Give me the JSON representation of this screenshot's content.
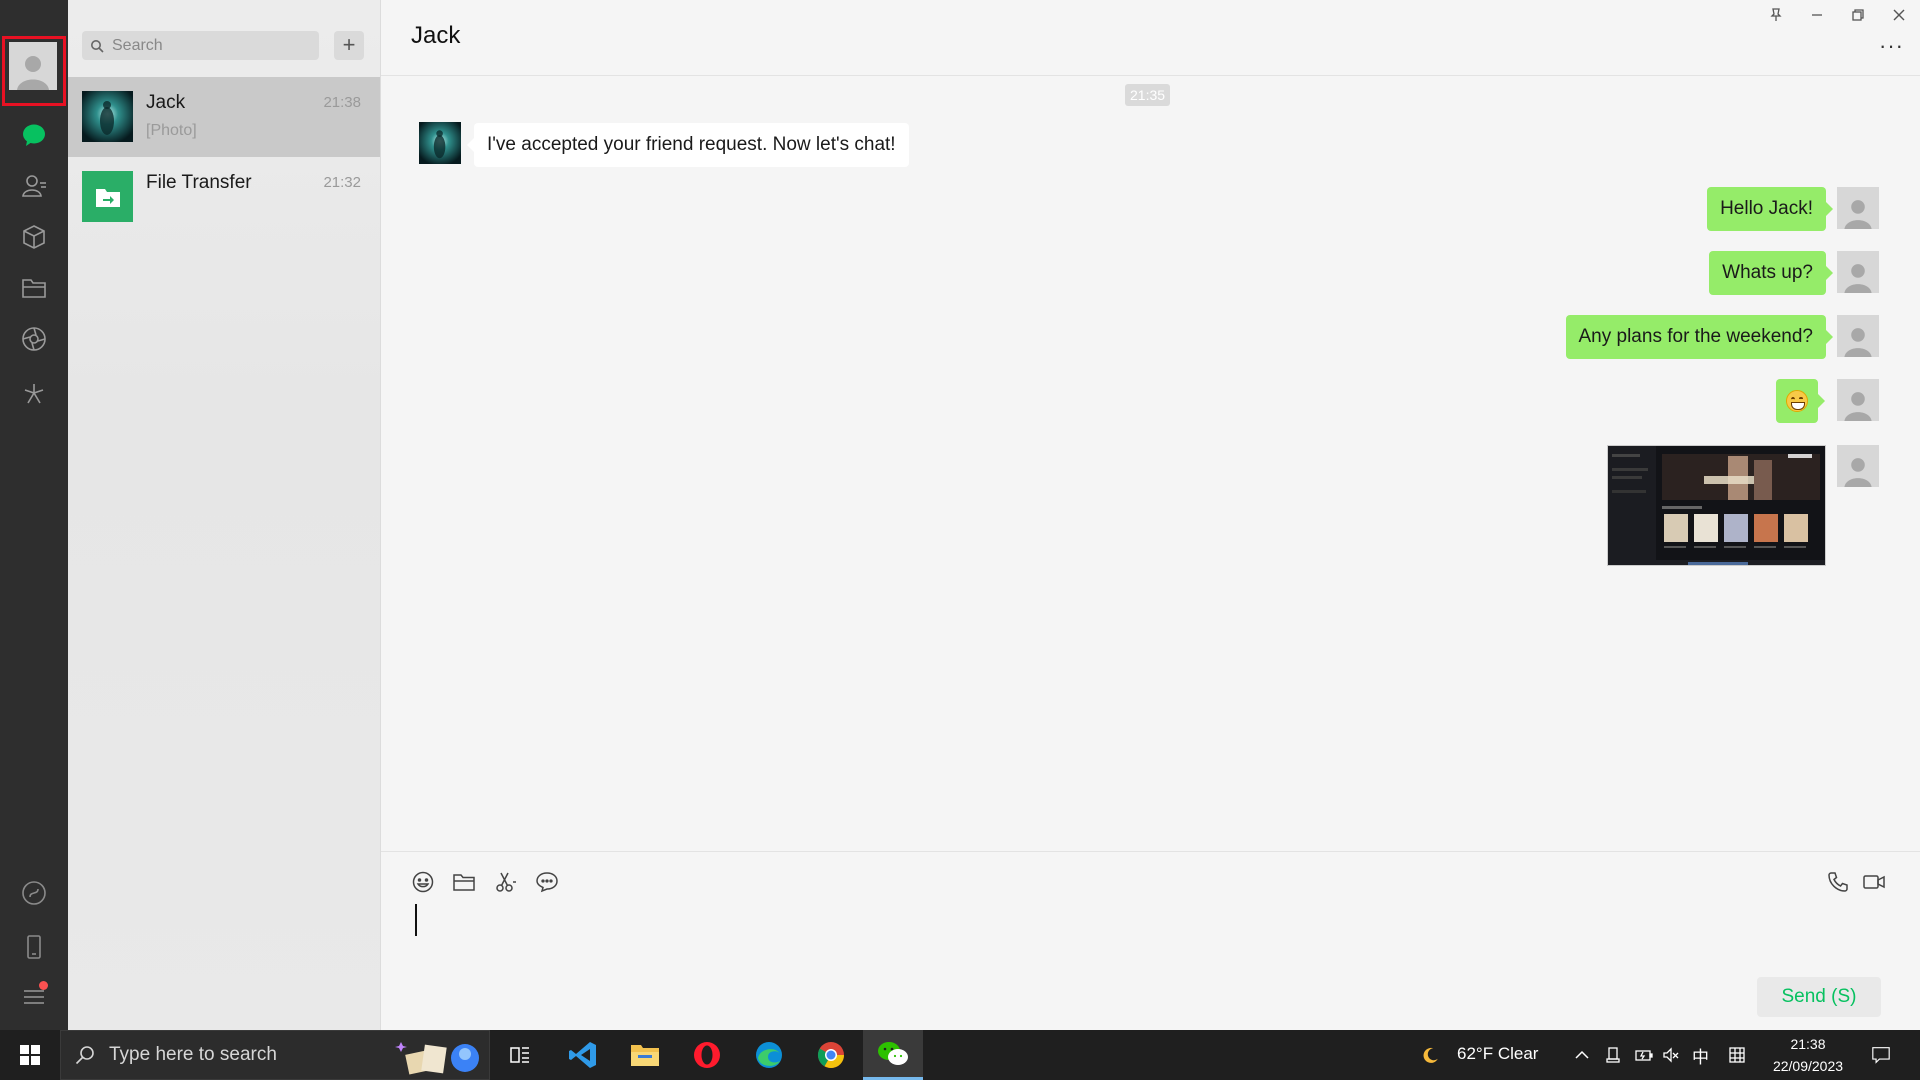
{
  "app": {
    "search": {
      "placeholder": "Search"
    },
    "add_label": "+"
  },
  "chats": [
    {
      "name": "Jack",
      "time": "21:38",
      "preview": "[Photo]",
      "active": true
    },
    {
      "name": "File Transfer",
      "time": "21:32",
      "preview": "",
      "active": false
    }
  ],
  "conversation": {
    "title": "Jack",
    "more_label": "···",
    "timestamp": "21:35",
    "messages": [
      {
        "from": "contact",
        "type": "text",
        "text": "I've accepted your friend request. Now let's chat!"
      },
      {
        "from": "me",
        "type": "text",
        "text": "Hello Jack!"
      },
      {
        "from": "me",
        "type": "text",
        "text": "Whats up?"
      },
      {
        "from": "me",
        "type": "text",
        "text": "Any plans for the weekend?"
      },
      {
        "from": "me",
        "type": "emoji",
        "emoji": "grinning-face"
      },
      {
        "from": "me",
        "type": "photo",
        "description": "screenshot"
      }
    ],
    "send_label": "Send (S)"
  },
  "taskbar": {
    "search_placeholder": "Type here to search",
    "weather": "62°F  Clear",
    "ime": "中",
    "time": "21:38",
    "date": "22/09/2023"
  },
  "colors": {
    "accent_green": "#07c160",
    "bubble_out": "#95ec69",
    "bubble_in": "#ffffff",
    "rail_bg": "#2e2e2e",
    "highlight_frame": "#e81123"
  }
}
